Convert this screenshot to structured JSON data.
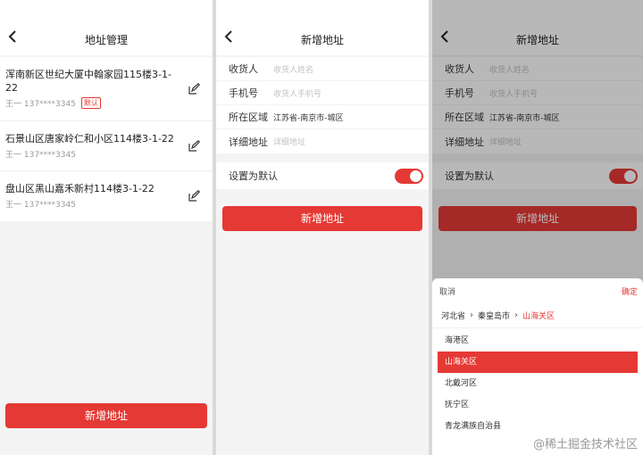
{
  "screen1": {
    "title": "地址管理",
    "addresses": [
      {
        "line": "浑南新区世纪大厦中翰家园115楼3-1-22",
        "contact": "王一 137****3345",
        "badge": "默认"
      },
      {
        "line": "石景山区唐家岭仁和小区114楼3-1-22",
        "contact": "王一 137****3345"
      },
      {
        "line": "盘山区黑山嘉禾新村114楼3-1-22",
        "contact": "王一 137****3345"
      }
    ],
    "add_button": "新增地址"
  },
  "screen2": {
    "title": "新增地址",
    "fields": {
      "receiver_label": "收货人",
      "receiver_placeholder": "收货人姓名",
      "phone_label": "手机号",
      "phone_placeholder": "收货人手机号",
      "region_label": "所在区域",
      "region_value": "江苏省-南京市-城区",
      "detail_label": "详细地址",
      "detail_placeholder": "详细地址"
    },
    "default_label": "设置为默认",
    "submit_button": "新增地址"
  },
  "screen3": {
    "title": "新增地址",
    "cancel": "取消",
    "confirm": "确定",
    "crumbs": [
      "河北省",
      "秦皇岛市",
      "山海关区"
    ],
    "options": [
      "海港区",
      "山海关区",
      "北戴河区",
      "抚宁区",
      "青龙满族自治县"
    ],
    "selected_option": "山海关区"
  },
  "watermark": "@稀土掘金技术社区",
  "colors": {
    "accent": "#e53935"
  }
}
